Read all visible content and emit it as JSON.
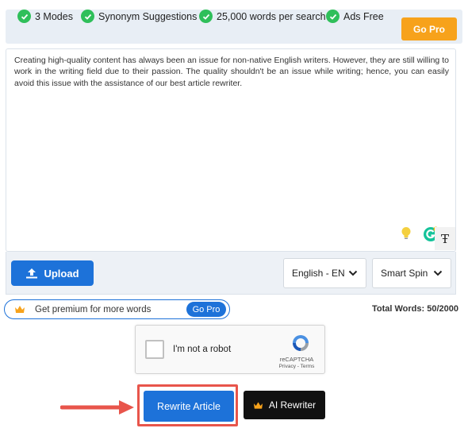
{
  "features": [
    {
      "label": "3 Modes",
      "icon": "check-circle-icon"
    },
    {
      "label": "Synonym Suggestions",
      "icon": "check-circle-icon"
    },
    {
      "label": "25,000 words per search",
      "icon": "check-circle-icon"
    },
    {
      "label": "Ads Free",
      "icon": "check-circle-icon"
    }
  ],
  "go_pro_top": "Go Pro",
  "editor": {
    "text": "Creating high-quality content has always been an issue for non-native English writers. However, they are still willing to work in the writing field due to their passion. The quality shouldn't be an issue while writing; hence, you can easily avoid this issue with the assistance of our best article rewriter."
  },
  "toolbar": {
    "upload_label": "Upload",
    "language": "English - EN",
    "mode": "Smart Spin"
  },
  "premium": {
    "text": "Get premium for more words",
    "button": "Go Pro"
  },
  "total_words": "Total Words: 50/2000",
  "captcha": {
    "label": "I'm not a robot",
    "brand": "reCAPTCHA",
    "links": "Privacy - Terms"
  },
  "actions": {
    "rewrite": "Rewrite Article",
    "ai": "AI Rewriter"
  },
  "colors": {
    "accent_blue": "#1d72d9",
    "orange": "#f7a21b",
    "check_green": "#2fbf5a",
    "highlight_red": "#e8554b"
  }
}
